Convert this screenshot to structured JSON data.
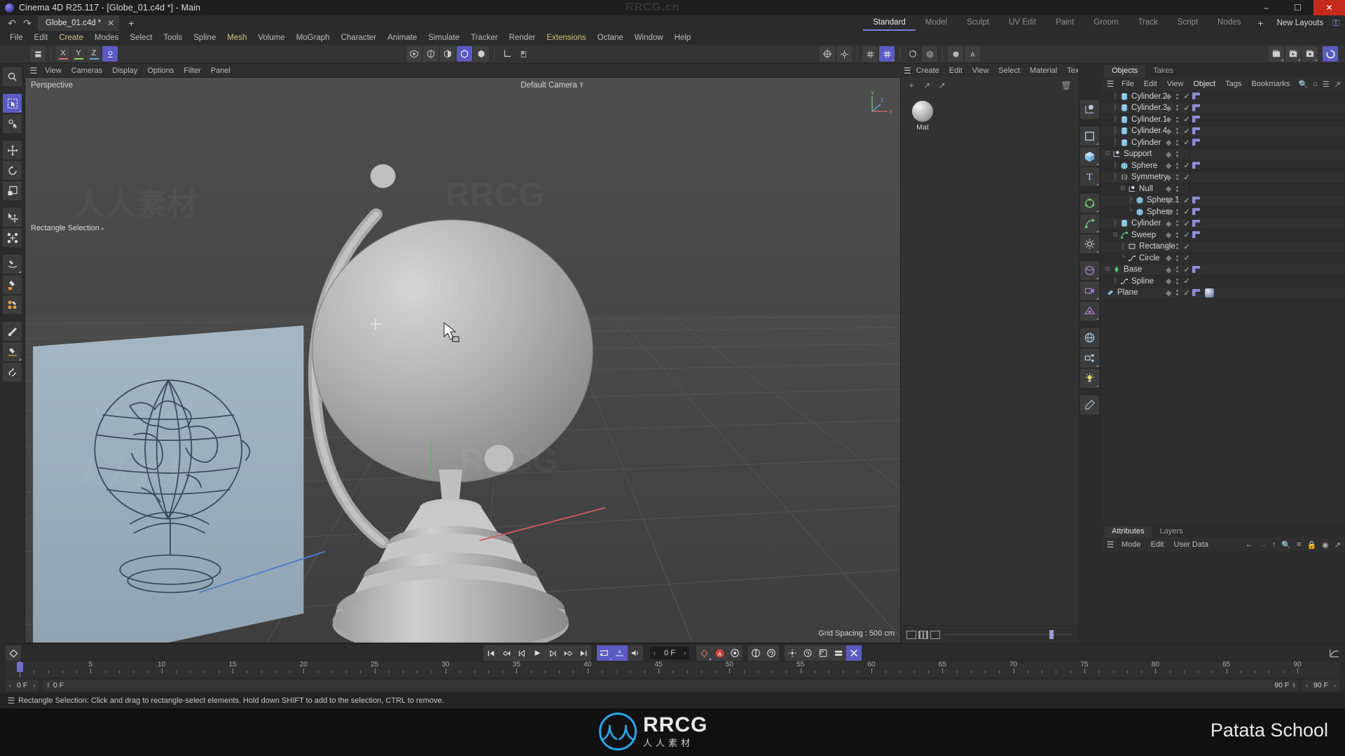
{
  "window": {
    "title": "Cinema 4D R25.117 - [Globe_01.c4d *] - Main",
    "watermark": "RRCG.cn",
    "minimize": "–",
    "maximize": "☐",
    "close": "✕"
  },
  "doc_tabs": {
    "undo": "↶",
    "redo": "↷",
    "tab_name": "Globe_01.c4d *",
    "close": "✕",
    "new_tab": "+"
  },
  "menubar": {
    "items": [
      {
        "label": "File",
        "highlight": false
      },
      {
        "label": "Edit",
        "highlight": false
      },
      {
        "label": "Create",
        "highlight": true
      },
      {
        "label": "Modes",
        "highlight": false
      },
      {
        "label": "Select",
        "highlight": false
      },
      {
        "label": "Tools",
        "highlight": false
      },
      {
        "label": "Spline",
        "highlight": false
      },
      {
        "label": "Mesh",
        "highlight": true
      },
      {
        "label": "Volume",
        "highlight": false
      },
      {
        "label": "MoGraph",
        "highlight": false
      },
      {
        "label": "Character",
        "highlight": false
      },
      {
        "label": "Animate",
        "highlight": false
      },
      {
        "label": "Simulate",
        "highlight": false
      },
      {
        "label": "Tracker",
        "highlight": false
      },
      {
        "label": "Render",
        "highlight": false
      },
      {
        "label": "Extensions",
        "highlight": true
      },
      {
        "label": "Octane",
        "highlight": false
      },
      {
        "label": "Window",
        "highlight": false
      },
      {
        "label": "Help",
        "highlight": false
      }
    ]
  },
  "layout_tabs": {
    "items": [
      {
        "label": "Standard",
        "active": true
      },
      {
        "label": "Model",
        "active": false
      },
      {
        "label": "Sculpt",
        "active": false
      },
      {
        "label": "UV Edit",
        "active": false
      },
      {
        "label": "Paint",
        "active": false
      },
      {
        "label": "Groom",
        "active": false
      },
      {
        "label": "Track",
        "active": false
      },
      {
        "label": "Script",
        "active": false
      },
      {
        "label": "Nodes",
        "active": false
      }
    ],
    "add": "+",
    "new_layouts": "New Layouts",
    "lock": "⚿"
  },
  "toolbar": {
    "axis_x": "X",
    "axis_y": "Y",
    "axis_z": "Z",
    "color_x": "#d96b6b",
    "color_y": "#8fce5a",
    "color_z": "#5aa9e0"
  },
  "viewport": {
    "menu": [
      "View",
      "Cameras",
      "Display",
      "Options",
      "Filter",
      "Panel"
    ],
    "label": "Perspective",
    "camera": "Default Camera",
    "active_tool": "Rectangle Selection",
    "grid_spacing": "Grid Spacing : 500 cm",
    "axis_labels": {
      "x": "X",
      "y": "Y",
      "z": "Z"
    },
    "watermarks": [
      "人人素材",
      "RRCG",
      "人人素材",
      "RRCG"
    ]
  },
  "material_manager": {
    "menu": [
      "Create",
      "Edit",
      "View",
      "Select",
      "Material",
      "Texture"
    ],
    "materials": [
      {
        "name": "Mat"
      }
    ]
  },
  "object_manager": {
    "tabs": [
      {
        "label": "Objects",
        "active": true
      },
      {
        "label": "Takes",
        "active": false
      }
    ],
    "menu": [
      "File",
      "Edit",
      "View",
      "Object",
      "Tags",
      "Bookmarks"
    ],
    "menu_active": "Object",
    "tree": [
      {
        "name": "Cylinder.2",
        "depth": 1,
        "icon": "cylinder",
        "tree": "├",
        "check": true,
        "tag": true
      },
      {
        "name": "Cylinder.3",
        "depth": 1,
        "icon": "cylinder",
        "tree": "├",
        "check": true,
        "tag": true
      },
      {
        "name": "Cylinder.1",
        "depth": 1,
        "icon": "cylinder",
        "tree": "├",
        "check": true,
        "tag": true
      },
      {
        "name": "Cylinder.4",
        "depth": 1,
        "icon": "cylinder",
        "tree": "├",
        "check": true,
        "tag": true
      },
      {
        "name": "Cylinder",
        "depth": 1,
        "icon": "cylinder",
        "tree": "├",
        "check": true,
        "tag": true
      },
      {
        "name": "Support",
        "depth": 0,
        "icon": "null",
        "tree": "⊟",
        "check": false,
        "tag": false
      },
      {
        "name": "Sphere",
        "depth": 1,
        "icon": "sphere",
        "tree": "├",
        "check": true,
        "tag": true
      },
      {
        "name": "Symmetry",
        "depth": 1,
        "icon": "symmetry",
        "tree": "├",
        "check": true,
        "tag": false
      },
      {
        "name": "Null",
        "depth": 2,
        "icon": "null",
        "tree": "⊟",
        "check": false,
        "tag": false
      },
      {
        "name": "Sphere.1",
        "depth": 3,
        "icon": "sphere",
        "tree": "├",
        "check": true,
        "tag": true
      },
      {
        "name": "Sphere",
        "depth": 3,
        "icon": "sphere",
        "tree": "└",
        "check": true,
        "tag": true
      },
      {
        "name": "Cylinder",
        "depth": 1,
        "icon": "cylinder",
        "tree": "├",
        "check": true,
        "tag": true
      },
      {
        "name": "Sweep",
        "depth": 1,
        "icon": "sweep",
        "tree": "⊟",
        "check": true,
        "tag": true
      },
      {
        "name": "Rectangle",
        "depth": 2,
        "icon": "rectangle",
        "tree": "├",
        "check": true,
        "tag": false
      },
      {
        "name": "Circle",
        "depth": 2,
        "icon": "spline",
        "tree": "└",
        "check": true,
        "tag": false
      },
      {
        "name": "Base",
        "depth": 0,
        "icon": "base",
        "tree": "⊟",
        "check": true,
        "tag": true
      },
      {
        "name": "Spline",
        "depth": 1,
        "icon": "spline",
        "tree": "├",
        "check": true,
        "tag": false
      },
      {
        "name": "Plane",
        "depth": 0,
        "icon": "plane",
        "tree": "",
        "check": true,
        "tag": true,
        "material_tag": true
      }
    ]
  },
  "attributes": {
    "tabs": [
      {
        "label": "Attributes",
        "active": true
      },
      {
        "label": "Layers",
        "active": false
      }
    ],
    "menu": [
      "Mode",
      "Edit",
      "User Data"
    ],
    "icons": [
      "back-arrow",
      "forward-arrow",
      "up-arrow",
      "search",
      "filter",
      "lock",
      "target",
      "open-window"
    ]
  },
  "timeline": {
    "transport": [
      "go-to-start",
      "previous-key",
      "previous-frame",
      "play",
      "next-frame",
      "next-key",
      "go-to-end"
    ],
    "loop_on": true,
    "autokey_on": true,
    "sound_on": true,
    "current_frame": "0 F",
    "ruler": {
      "start": 0,
      "end": 90,
      "ticks": [
        0,
        5,
        10,
        15,
        20,
        25,
        30,
        35,
        40,
        45,
        50,
        55,
        60,
        65,
        70,
        75,
        80,
        85,
        90
      ],
      "playhead": 0
    },
    "range_start": "0 F",
    "range_start_field": "0 F",
    "range_end": "90 F",
    "range_end_field": "90 F"
  },
  "statusbar": {
    "message": "Rectangle Selection: Click and drag to rectangle-select elements. Hold down SHIFT to add to the selection, CTRL to remove."
  },
  "bottom_band": {
    "logo_letters": "人人",
    "brand": "RRCG",
    "brand_sub": "人人素材",
    "right_text": "Patata School"
  }
}
